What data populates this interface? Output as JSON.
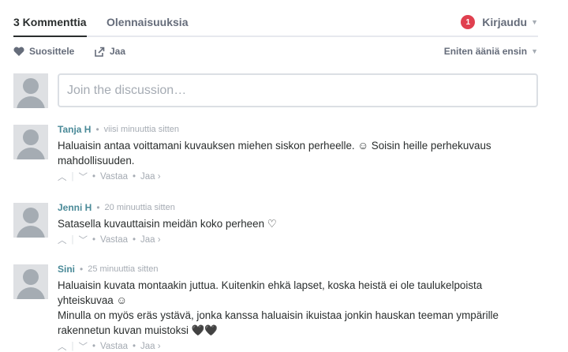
{
  "nav": {
    "tab_comments": "3 Kommenttia",
    "tab_other": "Olennaisuuksia",
    "notification_count": "1",
    "login_label": "Kirjaudu"
  },
  "toolbar": {
    "recommend_label": "Suosittele",
    "share_label": "Jaa",
    "sort_label": "Eniten ääniä ensin"
  },
  "compose": {
    "placeholder": "Join the discussion…"
  },
  "comments": [
    {
      "author": "Tanja H",
      "time": "viisi minuuttia sitten",
      "lines": [
        "Haluaisin antaa voittamani kuvauksen miehen siskon perheelle. ☺ Soisin heille perhekuvaus",
        "mahdollisuuden."
      ],
      "reply_label": "Vastaa",
      "share_label": "Jaa ›"
    },
    {
      "author": "Jenni H",
      "time": "20 minuuttia sitten",
      "lines": [
        "Satasella kuvauttaisin meidän koko perheen ♡"
      ],
      "reply_label": "Vastaa",
      "share_label": "Jaa ›"
    },
    {
      "author": "Sini",
      "time": "25 minuuttia sitten",
      "lines": [
        "Haluaisin kuvata montaakin juttua. Kuitenkin ehkä lapset, koska heistä ei ole taulukelpoista",
        "yhteiskuvaa ☺",
        "Minulla on myös eräs ystävä, jonka kanssa haluaisin ikuistaa jonkin hauskan teeman ympärille",
        "rakennetun kuvan muistoksi 🖤🖤"
      ],
      "reply_label": "Vastaa",
      "share_label": "Jaa ›"
    }
  ],
  "colors": {
    "author": "#4a8a98",
    "badge": "#e0404f",
    "muted": "#a5abb3"
  }
}
